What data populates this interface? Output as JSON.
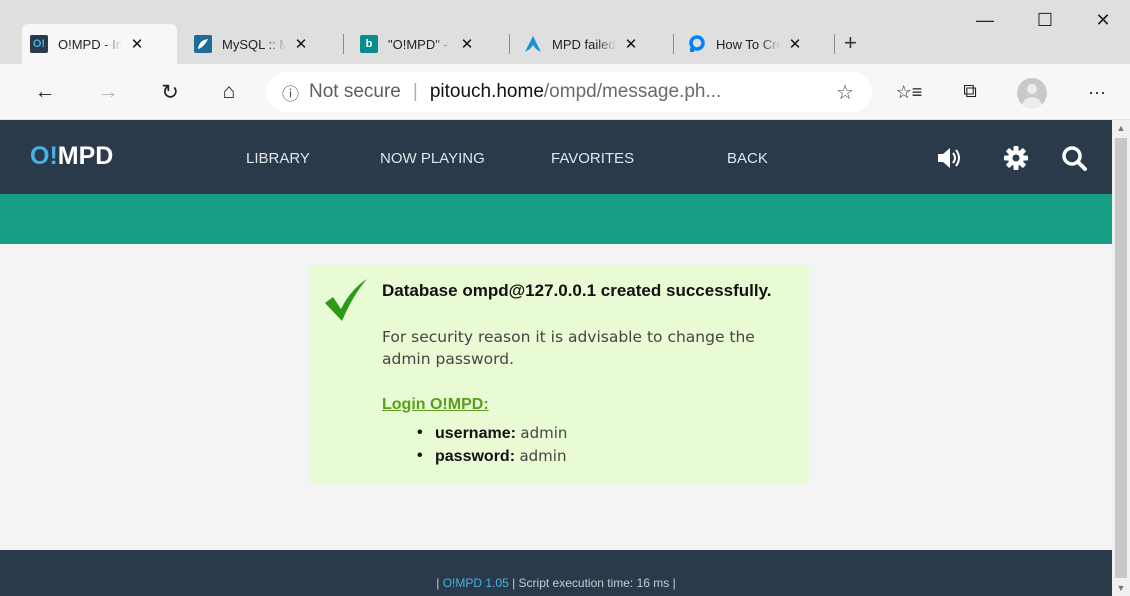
{
  "browser": {
    "tabs": [
      {
        "title": "O!MPD - Installation",
        "icon_text": "O!",
        "icon_color": "#2b3a4b",
        "active": true
      },
      {
        "title": "MySQL :: MySQL",
        "icon_text": "",
        "icon_color": "#1c6e94",
        "active": false
      },
      {
        "title": "\"O!MPD\" - Bing",
        "icon_text": "b",
        "icon_color": "#0a8c8e",
        "active": false
      },
      {
        "title": "MPD failed to",
        "icon_text": "",
        "icon_color": "#1793d1",
        "active": false
      },
      {
        "title": "How To Create",
        "icon_text": "",
        "icon_color": "#0080ff",
        "active": false
      }
    ],
    "address": {
      "security_label": "Not secure",
      "host": "pitouch.home",
      "path": "/ompd/message.ph..."
    }
  },
  "app": {
    "logo_prefix": "O!",
    "logo_suffix": "MPD",
    "nav": {
      "library": "LIBRARY",
      "now_playing": "NOW PLAYING",
      "favorites": "FAVORITES",
      "back": "BACK"
    },
    "colors": {
      "navbar": "#2b3a4b",
      "accent_bar": "#169e86",
      "message_bg": "#e9fbd4",
      "link": "#5a9e1c",
      "check": "#2e9a1a"
    }
  },
  "message": {
    "title": "Database ompd@127.0.0.1 created successfully.",
    "body": "For security reason it is advisable to change the admin password.",
    "login_link": "Login O!MPD:",
    "credentials": [
      {
        "key": "username:",
        "value": "admin"
      },
      {
        "key": "password:",
        "value": "admin"
      }
    ]
  },
  "footer": {
    "prefix": "| ",
    "version": "O!MPD 1.05",
    "suffix": " | Script execution time: 16 ms |"
  }
}
